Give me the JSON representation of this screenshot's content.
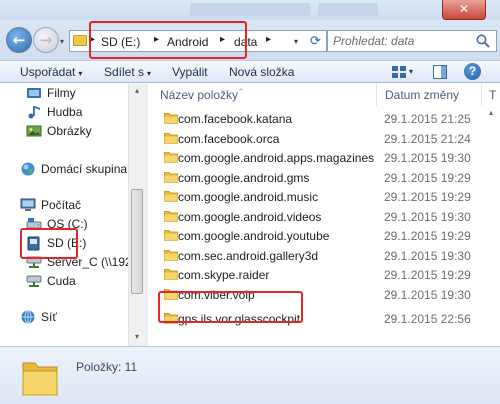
{
  "window": {
    "close_glyph": "✕"
  },
  "nav": {
    "back_glyph": "←",
    "forward_glyph": "→",
    "recent_glyph": "▾"
  },
  "address": {
    "breadcrumb": [
      "SD (E:)",
      "Android",
      "data"
    ],
    "separator": "▸",
    "dropdown_glyph": "▾",
    "refresh_glyph": "⟳"
  },
  "search": {
    "placeholder": "Prohledat: data"
  },
  "toolbar": {
    "organize_label": "Uspořádat",
    "share_label": "Sdílet s",
    "burn_label": "Vypálit",
    "new_folder_label": "Nová složka",
    "dropdown_glyph": "▾",
    "help_glyph": "?"
  },
  "sidebar": {
    "items": [
      {
        "label": "Filmy",
        "icon": "movies-icon"
      },
      {
        "label": "Hudba",
        "icon": "music-icon"
      },
      {
        "label": "Obrázky",
        "icon": "pictures-icon"
      },
      {
        "label": "Domácí skupina",
        "icon": "homegroup-icon"
      },
      {
        "label": "Počítač",
        "icon": "computer-icon"
      },
      {
        "label": "OS (C:)",
        "icon": "drive-icon"
      },
      {
        "label": "SD (E:)",
        "icon": "removable-drive-icon"
      },
      {
        "label": "Server_C (\\\\192.16",
        "icon": "network-drive-icon"
      },
      {
        "label": "Cuda",
        "icon": "network-drive-icon"
      },
      {
        "label": "Síť",
        "icon": "network-icon"
      }
    ],
    "scroll_up_glyph": "▴",
    "scroll_down_glyph": "▾"
  },
  "filelist": {
    "columns": {
      "name": "Název položky",
      "date": "Datum změny",
      "type": "T"
    },
    "sort_glyph": "^",
    "rows": [
      {
        "name": "com.facebook.katana",
        "date": "29.1.2015 21:25",
        "type": "S"
      },
      {
        "name": "com.facebook.orca",
        "date": "29.1.2015 21:24",
        "type": "S"
      },
      {
        "name": "com.google.android.apps.magazines",
        "date": "29.1.2015 19:30",
        "type": "S"
      },
      {
        "name": "com.google.android.gms",
        "date": "29.1.2015 19:29",
        "type": "S"
      },
      {
        "name": "com.google.android.music",
        "date": "29.1.2015 19:29",
        "type": "S"
      },
      {
        "name": "com.google.android.videos",
        "date": "29.1.2015 19:30",
        "type": "S"
      },
      {
        "name": "com.google.android.youtube",
        "date": "29.1.2015 19:29",
        "type": "S"
      },
      {
        "name": "com.sec.android.gallery3d",
        "date": "29.1.2015 19:30",
        "type": "S"
      },
      {
        "name": "com.skype.raider",
        "date": "29.1.2015 19:29",
        "type": "S"
      },
      {
        "name": "com.viber.voip",
        "date": "29.1.2015 19:30",
        "type": "S"
      },
      {
        "name": "gps.ils.vor.glasscockpit",
        "date": "29.1.2015 22:56",
        "type": "S"
      }
    ],
    "scroll_up_glyph": "▴"
  },
  "details": {
    "count_label": "Položky: 11"
  },
  "colors": {
    "highlight": "#e3262c",
    "folder": "#f0c94a",
    "accent": "#2f6db3"
  }
}
